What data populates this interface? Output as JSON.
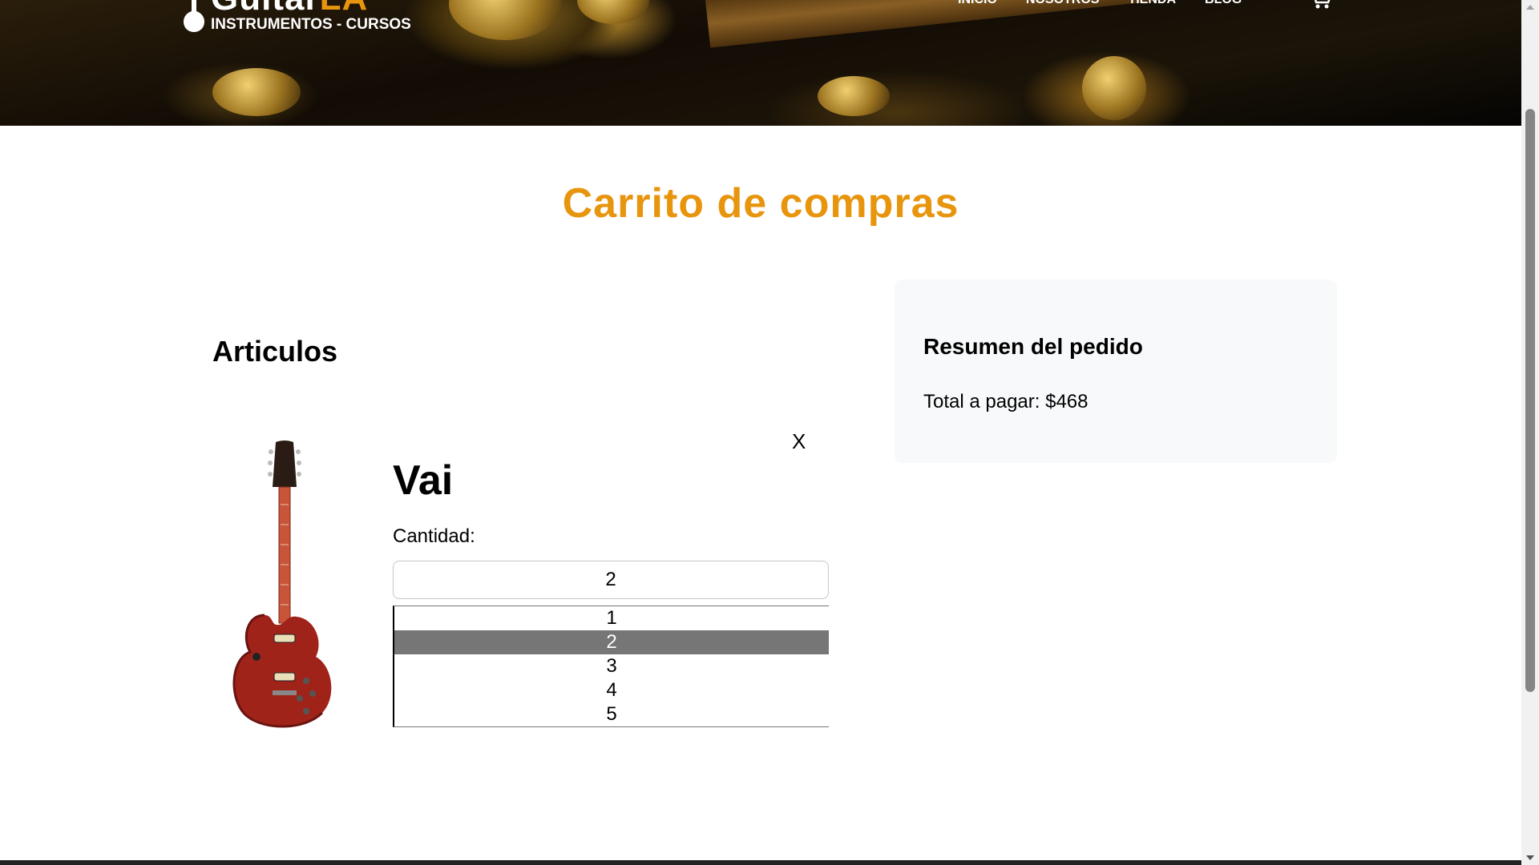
{
  "header": {
    "brand_main": "Guitar",
    "brand_accent": "LA",
    "tagline": "INSTRUMENTOS - CURSOS",
    "nav": [
      "INICIO",
      "NOSOTROS",
      "TIENDA",
      "BLOG"
    ],
    "cart_icon": "cart-icon",
    "accent_color": "#e8950e"
  },
  "page": {
    "title": "Carrito de compras"
  },
  "items": {
    "heading": "Articulos",
    "list": [
      {
        "name": "Vai",
        "remove_label": "X",
        "quantity_label": "Cantidad:",
        "quantity_value": "2",
        "quantity_options": [
          "1",
          "2",
          "3",
          "4",
          "5"
        ],
        "selected_option": "2"
      }
    ]
  },
  "summary": {
    "title": "Resumen del pedido",
    "total_text": "Total a pagar: $468"
  }
}
